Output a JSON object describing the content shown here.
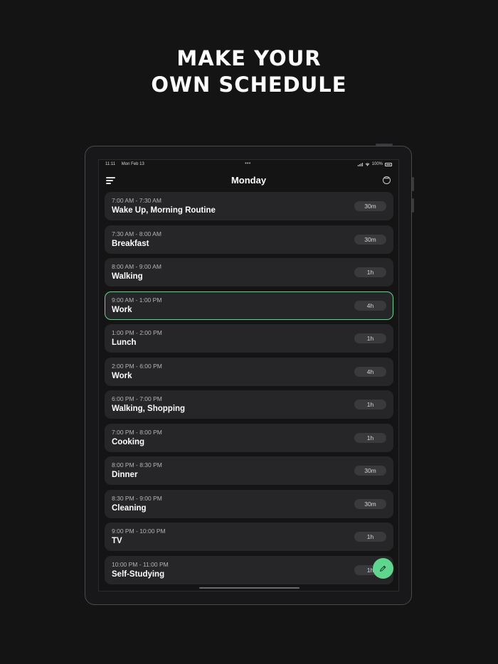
{
  "headline": {
    "line1": "MAKE YOUR",
    "line2": "OWN SCHEDULE"
  },
  "status_bar": {
    "time": "11:11",
    "date": "Mon Feb 13",
    "dots": "•••",
    "battery": "100%"
  },
  "nav": {
    "title": "Monday",
    "more_glyph": "•••"
  },
  "schedule": [
    {
      "time": "7:00 AM - 7:30 AM",
      "title": "Wake Up, Morning Routine",
      "duration": "30m",
      "active": false
    },
    {
      "time": "7:30 AM - 8:00 AM",
      "title": "Breakfast",
      "duration": "30m",
      "active": false
    },
    {
      "time": "8:00 AM - 9:00 AM",
      "title": "Walking",
      "duration": "1h",
      "active": false
    },
    {
      "time": "9:00 AM - 1:00 PM",
      "title": "Work",
      "duration": "4h",
      "active": true
    },
    {
      "time": "1:00 PM - 2:00 PM",
      "title": "Lunch",
      "duration": "1h",
      "active": false
    },
    {
      "time": "2:00 PM - 6:00 PM",
      "title": "Work",
      "duration": "4h",
      "active": false
    },
    {
      "time": "6:00 PM - 7:00 PM",
      "title": "Walking, Shopping",
      "duration": "1h",
      "active": false
    },
    {
      "time": "7:00 PM - 8:00 PM",
      "title": "Cooking",
      "duration": "1h",
      "active": false
    },
    {
      "time": "8:00 PM - 8:30 PM",
      "title": "Dinner",
      "duration": "30m",
      "active": false
    },
    {
      "time": "8:30 PM - 9:00 PM",
      "title": "Cleaning",
      "duration": "30m",
      "active": false
    },
    {
      "time": "9:00 PM - 10:00 PM",
      "title": "TV",
      "duration": "1h",
      "active": false
    },
    {
      "time": "10:00 PM - 11:00 PM",
      "title": "Self-Studying",
      "duration": "1h",
      "active": false
    }
  ],
  "colors": {
    "accent": "#5fd68e",
    "background": "#141415",
    "card": "#262628"
  },
  "icons": {
    "menu": "menu-icon",
    "more": "more-icon",
    "fab": "pencil-icon"
  }
}
